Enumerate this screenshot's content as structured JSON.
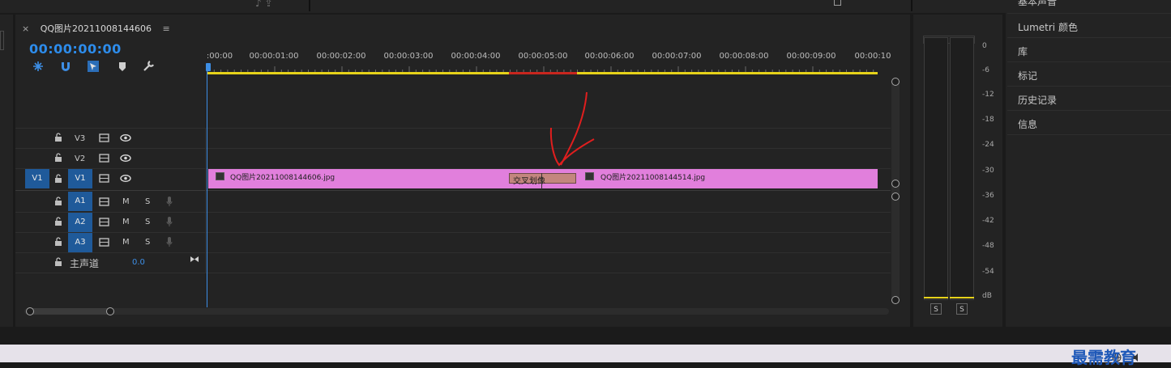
{
  "sequence": {
    "title": "QQ图片20211008144606",
    "close_symbol": "×",
    "menu_symbol": "≡",
    "timecode": "00:00:00:00"
  },
  "ruler": {
    "labels": [
      ":00:00",
      "00:00:01:00",
      "00:00:02:00",
      "00:00:03:00",
      "00:00:04:00",
      "00:00:05:00",
      "00:00:06:00",
      "00:00:07:00",
      "00:00:08:00",
      "00:00:09:00",
      "00:00:10"
    ]
  },
  "tracks": {
    "video": [
      {
        "name": "V3"
      },
      {
        "name": "V2"
      },
      {
        "name": "V1",
        "source": "V1"
      }
    ],
    "audio": [
      {
        "name": "A1",
        "mute": "M",
        "solo": "S"
      },
      {
        "name": "A2",
        "mute": "M",
        "solo": "S"
      },
      {
        "name": "A3",
        "mute": "M",
        "solo": "S"
      }
    ],
    "master": {
      "label": "主声道",
      "value": "0.0"
    }
  },
  "clips": {
    "clip1": "QQ图片20211008144606.jpg",
    "clip2": "QQ图片20211008144514.jpg",
    "fx_badge": "fx",
    "transition": "交叉划像"
  },
  "meter": {
    "scale": [
      "0",
      "-6",
      "-12",
      "-18",
      "-24",
      "-30",
      "-36",
      "-42",
      "-48",
      "-54",
      "dB"
    ],
    "solo_left": "S",
    "solo_right": "S"
  },
  "right_panel": {
    "items": [
      "基本声音",
      "Lumetri 颜色",
      "库",
      "标记",
      "历史记录",
      "信息"
    ]
  },
  "watermark": "最需教育",
  "colors": {
    "accent_blue": "#2d8ceb",
    "clip_pink": "#e17fdc",
    "transition": "#c3867e",
    "work_area": "#e6d21a",
    "render_red": "#c8261e",
    "annotation_red": "#e01e1e"
  },
  "icons": [
    "ripple-edit-icon",
    "snap-icon",
    "linked-selection-icon",
    "marker-icon",
    "wrench-icon",
    "lock-icon",
    "filmstrip-icon",
    "eye-icon",
    "microphone-icon",
    "keyframe-bowtie-icon"
  ]
}
